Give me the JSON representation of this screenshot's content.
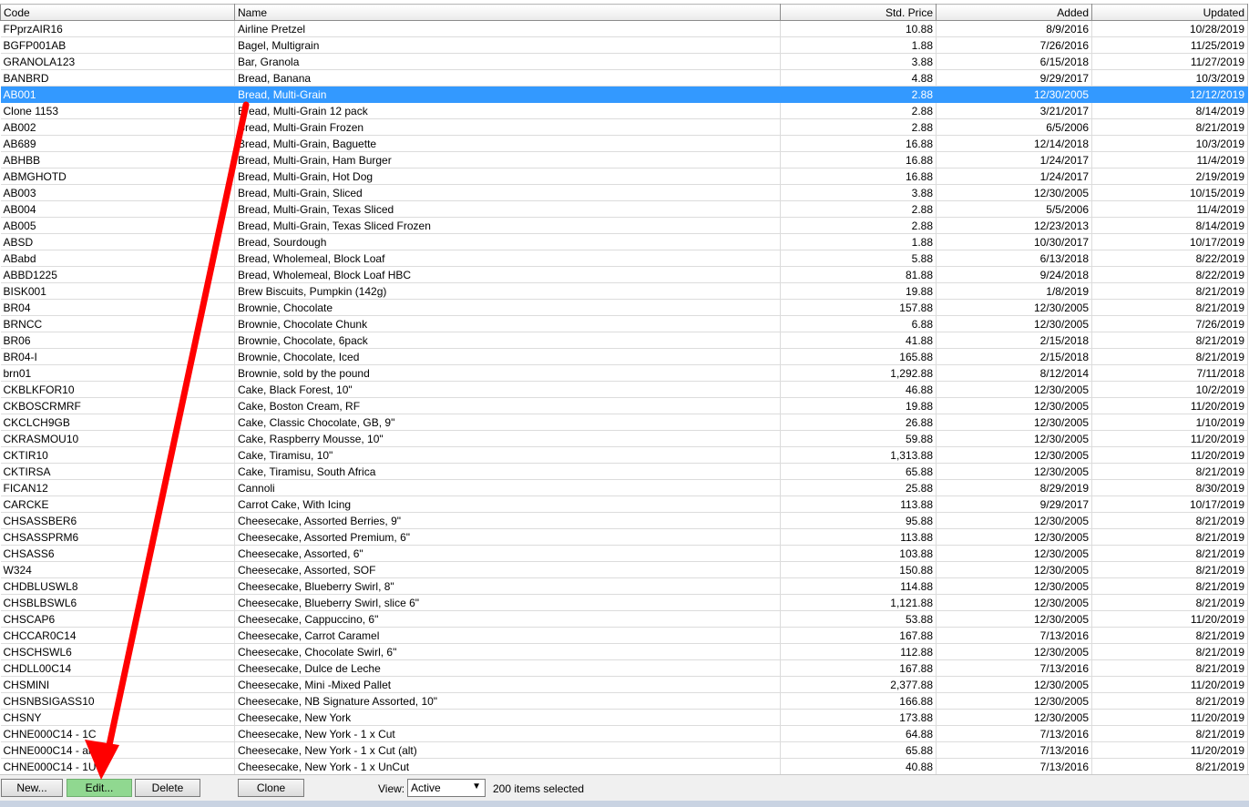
{
  "table": {
    "columns": {
      "code": "Code",
      "name": "Name",
      "price": "Std. Price",
      "added": "Added",
      "updated": "Updated"
    },
    "selected_index": 4,
    "rows": [
      {
        "code": "FPprzAIR16",
        "name": "Airline Pretzel",
        "price": "10.88",
        "added": "8/9/2016",
        "updated": "10/28/2019"
      },
      {
        "code": "BGFP001AB",
        "name": "Bagel, Multigrain",
        "price": "1.88",
        "added": "7/26/2016",
        "updated": "11/25/2019"
      },
      {
        "code": "GRANOLA123",
        "name": "Bar, Granola",
        "price": "3.88",
        "added": "6/15/2018",
        "updated": "11/27/2019"
      },
      {
        "code": "BANBRD",
        "name": "Bread, Banana",
        "price": "4.88",
        "added": "9/29/2017",
        "updated": "10/3/2019"
      },
      {
        "code": "AB001",
        "name": "Bread, Multi-Grain",
        "price": "2.88",
        "added": "12/30/2005",
        "updated": "12/12/2019"
      },
      {
        "code": "Clone 1153",
        "name": "Bread, Multi-Grain 12 pack",
        "price": "2.88",
        "added": "3/21/2017",
        "updated": "8/14/2019"
      },
      {
        "code": "AB002",
        "name": "Bread, Multi-Grain Frozen",
        "price": "2.88",
        "added": "6/5/2006",
        "updated": "8/21/2019"
      },
      {
        "code": "AB689",
        "name": "Bread, Multi-Grain, Baguette",
        "price": "16.88",
        "added": "12/14/2018",
        "updated": "10/3/2019"
      },
      {
        "code": "ABHBB",
        "name": "Bread, Multi-Grain, Ham Burger",
        "price": "16.88",
        "added": "1/24/2017",
        "updated": "11/4/2019"
      },
      {
        "code": "ABMGHOTD",
        "name": "Bread, Multi-Grain, Hot Dog",
        "price": "16.88",
        "added": "1/24/2017",
        "updated": "2/19/2019"
      },
      {
        "code": "AB003",
        "name": "Bread, Multi-Grain, Sliced",
        "price": "3.88",
        "added": "12/30/2005",
        "updated": "10/15/2019"
      },
      {
        "code": "AB004",
        "name": "Bread, Multi-Grain, Texas Sliced",
        "price": "2.88",
        "added": "5/5/2006",
        "updated": "11/4/2019"
      },
      {
        "code": "AB005",
        "name": "Bread, Multi-Grain, Texas Sliced Frozen",
        "price": "2.88",
        "added": "12/23/2013",
        "updated": "8/14/2019"
      },
      {
        "code": "ABSD",
        "name": "Bread, Sourdough",
        "price": "1.88",
        "added": "10/30/2017",
        "updated": "10/17/2019"
      },
      {
        "code": "ABabd",
        "name": "Bread, Wholemeal, Block Loaf",
        "price": "5.88",
        "added": "6/13/2018",
        "updated": "8/22/2019"
      },
      {
        "code": "ABBD1225",
        "name": "Bread, Wholemeal, Block Loaf HBC",
        "price": "81.88",
        "added": "9/24/2018",
        "updated": "8/22/2019"
      },
      {
        "code": "BISK001",
        "name": "Brew Biscuits, Pumpkin (142g)",
        "price": "19.88",
        "added": "1/8/2019",
        "updated": "8/21/2019"
      },
      {
        "code": "BR04",
        "name": "Brownie, Chocolate",
        "price": "157.88",
        "added": "12/30/2005",
        "updated": "8/21/2019"
      },
      {
        "code": "BRNCC",
        "name": "Brownie, Chocolate Chunk",
        "price": "6.88",
        "added": "12/30/2005",
        "updated": "7/26/2019"
      },
      {
        "code": "BR06",
        "name": "Brownie, Chocolate, 6pack",
        "price": "41.88",
        "added": "2/15/2018",
        "updated": "8/21/2019"
      },
      {
        "code": "BR04-I",
        "name": "Brownie, Chocolate, Iced",
        "price": "165.88",
        "added": "2/15/2018",
        "updated": "8/21/2019"
      },
      {
        "code": "brn01",
        "name": "Brownie, sold by the pound",
        "price": "1,292.88",
        "added": "8/12/2014",
        "updated": "7/11/2018"
      },
      {
        "code": "CKBLKFOR10",
        "name": "Cake, Black Forest, 10\"",
        "price": "46.88",
        "added": "12/30/2005",
        "updated": "10/2/2019"
      },
      {
        "code": "CKBOSCRMRF",
        "name": "Cake, Boston Cream, RF",
        "price": "19.88",
        "added": "12/30/2005",
        "updated": "11/20/2019"
      },
      {
        "code": "CKCLCH9GB",
        "name": "Cake, Classic Chocolate, GB, 9\"",
        "price": "26.88",
        "added": "12/30/2005",
        "updated": "1/10/2019"
      },
      {
        "code": "CKRASMOU10",
        "name": "Cake, Raspberry Mousse, 10\"",
        "price": "59.88",
        "added": "12/30/2005",
        "updated": "11/20/2019"
      },
      {
        "code": "CKTIR10",
        "name": "Cake, Tiramisu, 10\"",
        "price": "1,313.88",
        "added": "12/30/2005",
        "updated": "11/20/2019"
      },
      {
        "code": "CKTIRSA",
        "name": "Cake, Tiramisu, South Africa",
        "price": "65.88",
        "added": "12/30/2005",
        "updated": "8/21/2019"
      },
      {
        "code": "FICAN12",
        "name": "Cannoli",
        "price": "25.88",
        "added": "8/29/2019",
        "updated": "8/30/2019"
      },
      {
        "code": "CARCKE",
        "name": "Carrot Cake, With Icing",
        "price": "113.88",
        "added": "9/29/2017",
        "updated": "10/17/2019"
      },
      {
        "code": "CHSASSBER6",
        "name": "Cheesecake, Assorted Berries, 9\"",
        "price": "95.88",
        "added": "12/30/2005",
        "updated": "8/21/2019"
      },
      {
        "code": "CHSASSPRM6",
        "name": "Cheesecake, Assorted Premium, 6\"",
        "price": "113.88",
        "added": "12/30/2005",
        "updated": "8/21/2019"
      },
      {
        "code": "CHSASS6",
        "name": "Cheesecake, Assorted, 6\"",
        "price": "103.88",
        "added": "12/30/2005",
        "updated": "8/21/2019"
      },
      {
        "code": "W324",
        "name": "Cheesecake, Assorted, SOF",
        "price": "150.88",
        "added": "12/30/2005",
        "updated": "8/21/2019"
      },
      {
        "code": "CHDBLUSWL8",
        "name": "Cheesecake, Blueberry Swirl, 8\"",
        "price": "114.88",
        "added": "12/30/2005",
        "updated": "8/21/2019"
      },
      {
        "code": "CHSBLBSWL6",
        "name": "Cheesecake, Blueberry Swirl, slice  6\"",
        "price": "1,121.88",
        "added": "12/30/2005",
        "updated": "8/21/2019"
      },
      {
        "code": "CHSCAP6",
        "name": "Cheesecake, Cappuccino, 6\"",
        "price": "53.88",
        "added": "12/30/2005",
        "updated": "11/20/2019"
      },
      {
        "code": "CHCCAR0C14",
        "name": "Cheesecake, Carrot Caramel",
        "price": "167.88",
        "added": "7/13/2016",
        "updated": "8/21/2019"
      },
      {
        "code": "CHSCHSWL6",
        "name": "Cheesecake, Chocolate Swirl, 6\"",
        "price": "112.88",
        "added": "12/30/2005",
        "updated": "8/21/2019"
      },
      {
        "code": "CHDLL00C14",
        "name": "Cheesecake, Dulce de Leche",
        "price": "167.88",
        "added": "7/13/2016",
        "updated": "8/21/2019"
      },
      {
        "code": "CHSMINI",
        "name": "Cheesecake, Mini -Mixed Pallet",
        "price": "2,377.88",
        "added": "12/30/2005",
        "updated": "11/20/2019"
      },
      {
        "code": "CHSNBSIGASS10",
        "name": "Cheesecake, NB Signature Assorted, 10\"",
        "price": "166.88",
        "added": "12/30/2005",
        "updated": "8/21/2019"
      },
      {
        "code": "CHSNY",
        "name": "Cheesecake, New York",
        "price": "173.88",
        "added": "12/30/2005",
        "updated": "11/20/2019"
      },
      {
        "code": "CHNE000C14 - 1C",
        "name": "Cheesecake, New York - 1 x Cut",
        "price": "64.88",
        "added": "7/13/2016",
        "updated": "8/21/2019"
      },
      {
        "code": "CHNE000C14 - alt",
        "name": "Cheesecake, New York - 1 x Cut (alt)",
        "price": "65.88",
        "added": "7/13/2016",
        "updated": "11/20/2019"
      },
      {
        "code": "CHNE000C14 - 1U",
        "name": "Cheesecake, New York - 1 x UnCut",
        "price": "40.88",
        "added": "7/13/2016",
        "updated": "8/21/2019"
      }
    ]
  },
  "toolbar": {
    "new_label": "New...",
    "edit_label": "Edit...",
    "delete_label": "Delete",
    "clone_label": "Clone",
    "view_label": "View:",
    "view_value": "Active",
    "selected_text": "200 items selected"
  },
  "colors": {
    "selection": "#3399ff",
    "edit_button": "#90d890",
    "annotation_arrow": "#ff0000"
  }
}
